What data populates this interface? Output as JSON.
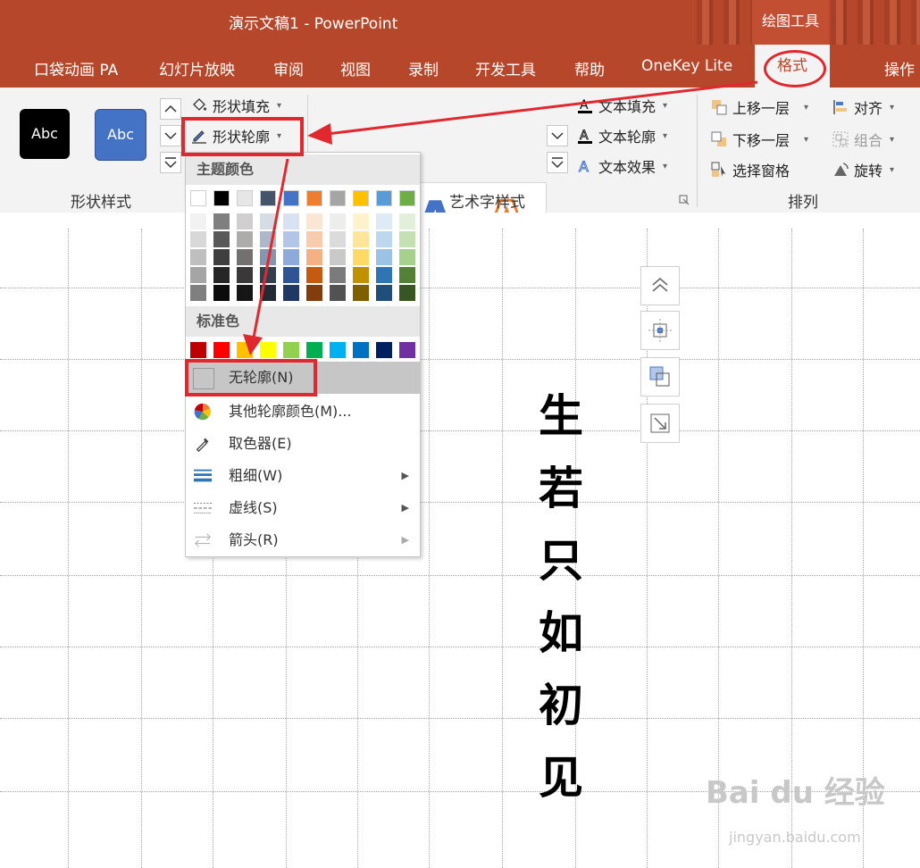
{
  "window": {
    "title": "演示文稿1  -  PowerPoint",
    "context_label": "绘图工具"
  },
  "tabs": [
    {
      "label": "口袋动画 PA"
    },
    {
      "label": "幻灯片放映"
    },
    {
      "label": "审阅"
    },
    {
      "label": "视图"
    },
    {
      "label": "录制"
    },
    {
      "label": "开发工具"
    },
    {
      "label": "帮助"
    },
    {
      "label": "OneKey Lite"
    },
    {
      "label": "格式",
      "active": true
    },
    {
      "label": "操作"
    }
  ],
  "ribbon": {
    "shape_styles": {
      "label": "形状样式",
      "styles": [
        {
          "text": "Abc",
          "fill": "#000000"
        },
        {
          "text": "Abc",
          "fill": "#4472c4"
        }
      ],
      "fill_button": "形状填充",
      "outline_button": "形状轮廓"
    },
    "wordart": {
      "label": "艺术字样式",
      "samples": [
        "A",
        "A",
        "A"
      ],
      "text_fill": "文本填充",
      "text_outline": "文本轮廓",
      "text_effects": "文本效果"
    },
    "arrange": {
      "label": "排列",
      "bring_forward": "上移一层",
      "send_backward": "下移一层",
      "selection_pane": "选择窗格",
      "align": "对齐",
      "group": "组合",
      "rotate": "旋转"
    }
  },
  "outline_menu": {
    "theme_colors_header": "主题颜色",
    "standard_colors_header": "标准色",
    "theme_top_row": [
      "#ffffff",
      "#000000",
      "#e7e6e6",
      "#44546a",
      "#4472c4",
      "#ed7d31",
      "#a5a5a5",
      "#ffc000",
      "#5b9bd5",
      "#70ad47"
    ],
    "theme_shades": [
      [
        "#f2f2f2",
        "#7f7f7f",
        "#d0cece",
        "#d6dce4",
        "#d9e2f3",
        "#fbe5d5",
        "#ededed",
        "#fff2cc",
        "#deebf6",
        "#e2efd9"
      ],
      [
        "#d8d8d8",
        "#595959",
        "#aeabab",
        "#adb9ca",
        "#b4c6e7",
        "#f7cbac",
        "#dbdbdb",
        "#ffe598",
        "#bdd7ee",
        "#c5e0b3"
      ],
      [
        "#bfbfbf",
        "#3f3f3f",
        "#757070",
        "#8496b0",
        "#8eaadb",
        "#f4b183",
        "#c9c9c9",
        "#ffd965",
        "#9cc3e5",
        "#a8d08d"
      ],
      [
        "#a5a5a5",
        "#262626",
        "#3a3838",
        "#323f4f",
        "#2f5496",
        "#c55a11",
        "#7b7b7b",
        "#bf9000",
        "#2e75b5",
        "#538135"
      ],
      [
        "#7f7f7f",
        "#0c0c0c",
        "#171616",
        "#222a35",
        "#1f3864",
        "#833c0b",
        "#525252",
        "#7f6000",
        "#1e4e79",
        "#375623"
      ]
    ],
    "standard_colors": [
      "#c00000",
      "#ff0000",
      "#ffc000",
      "#ffff00",
      "#92d050",
      "#00b050",
      "#00b0f0",
      "#0070c0",
      "#002060",
      "#7030a0"
    ],
    "items": {
      "no_outline": "无轮廓(N)",
      "more_colors": "其他轮廓颜色(M)...",
      "eyedropper": "取色器(E)",
      "weight": "粗细(W)",
      "dashes": "虚线(S)",
      "arrows": "箭头(R)"
    }
  },
  "slide": {
    "vertical_text": [
      "生",
      "若",
      "只",
      "如",
      "初",
      "见"
    ]
  },
  "watermark": {
    "logo": "Bai du 经验",
    "url": "jingyan.baidu.com"
  }
}
